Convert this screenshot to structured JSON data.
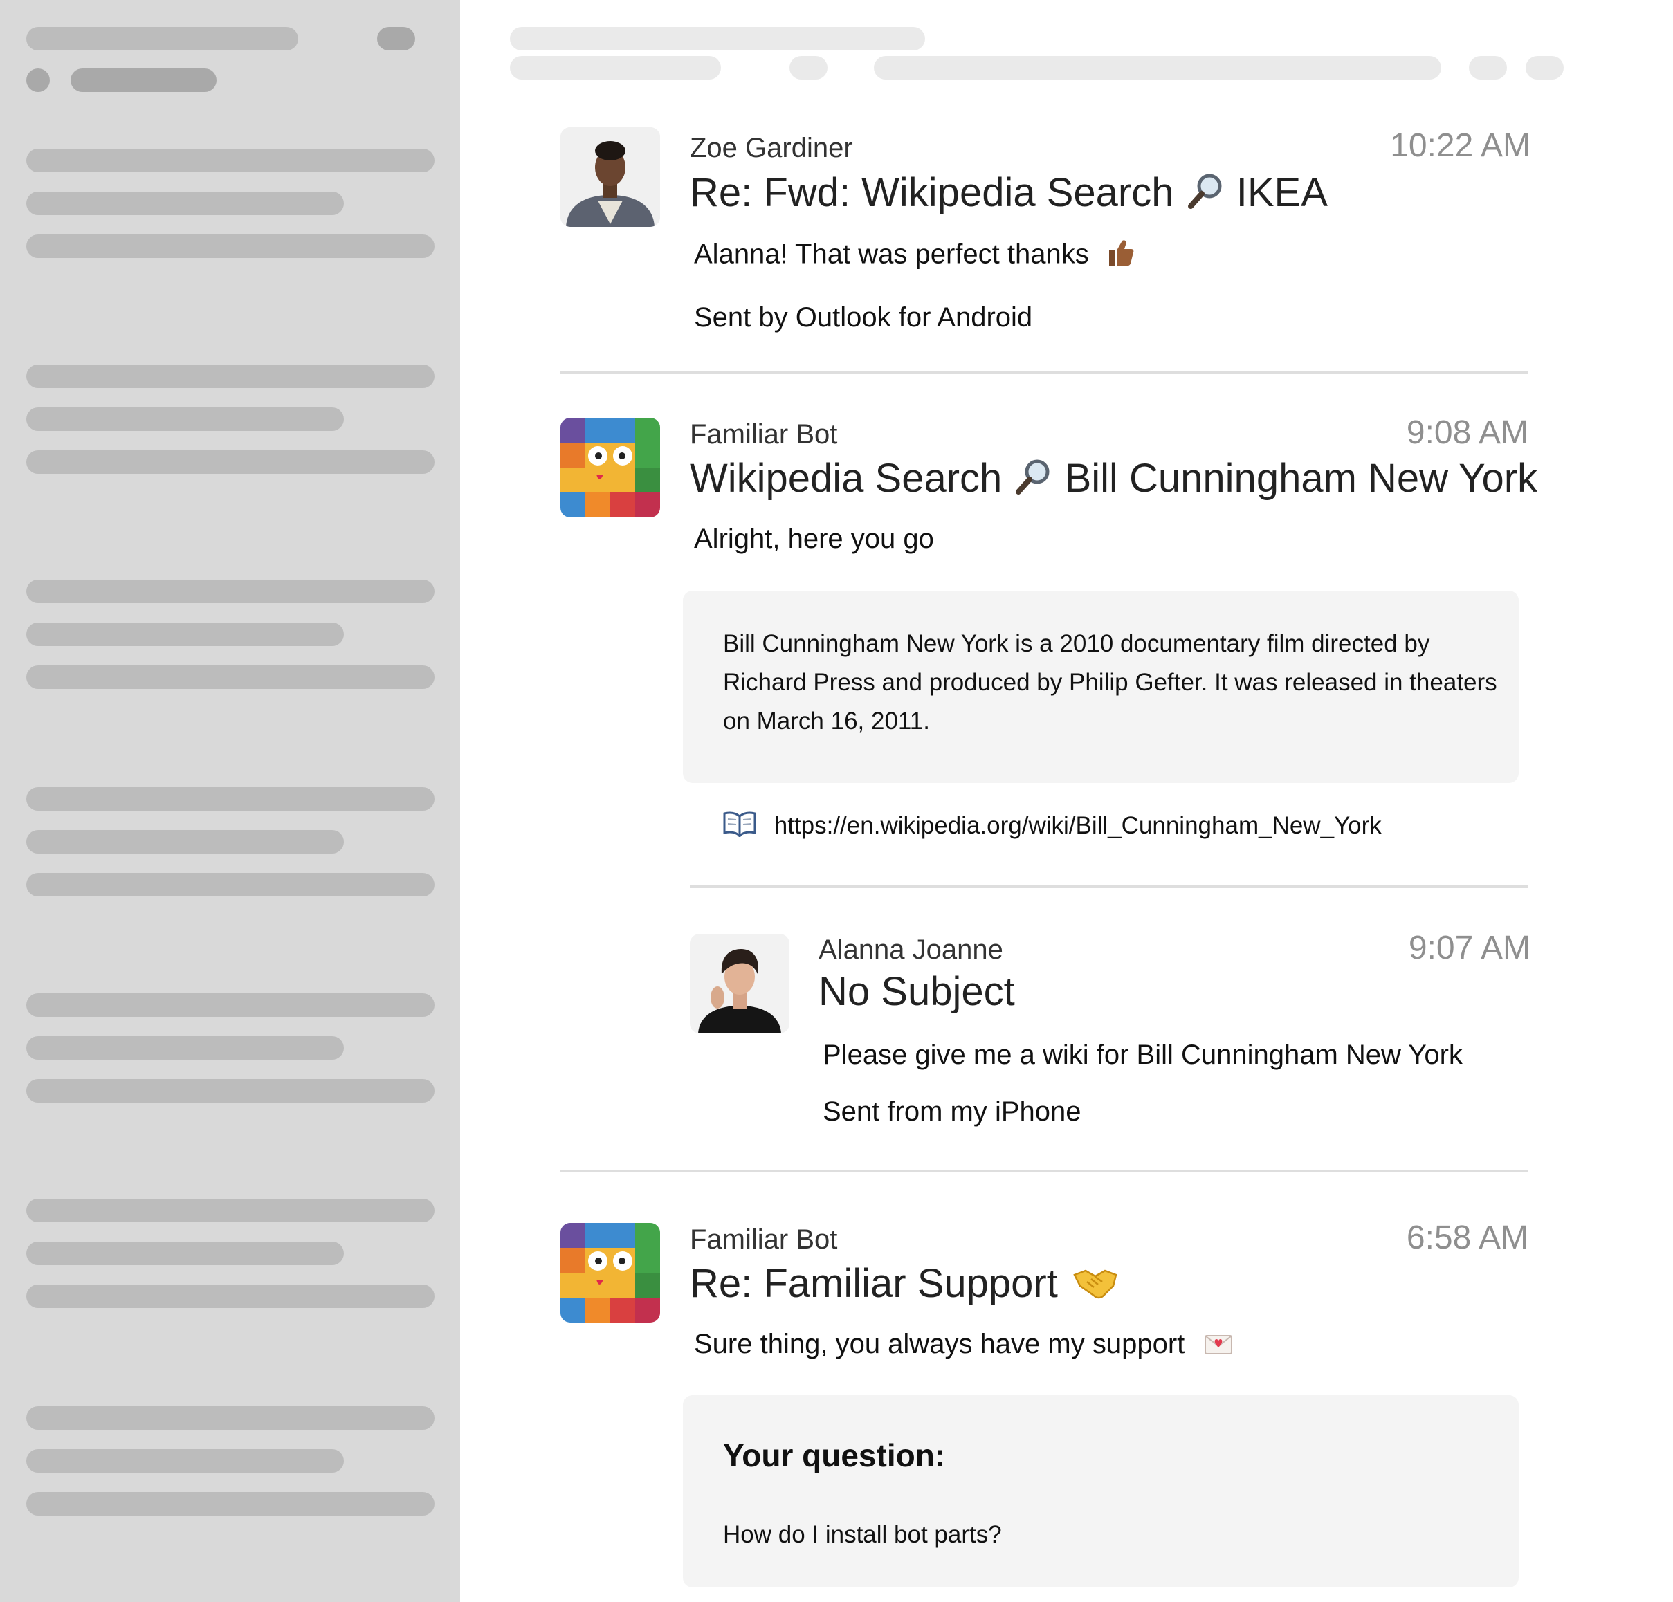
{
  "messages": [
    {
      "sender": "Zoe Gardiner",
      "time": "10:22 AM",
      "subject_pre": "Re: Fwd: Wikipedia Search",
      "subject_post": "IKEA",
      "body_lines": [
        "Alanna! That was perfect thanks",
        "Sent by Outlook for Android"
      ]
    },
    {
      "sender": "Familiar Bot",
      "time": "9:08 AM",
      "subject_pre": "Wikipedia Search",
      "subject_post": "Bill Cunningham New York",
      "body_lines": [
        "Alright, here you go"
      ],
      "card_text": "Bill Cunningham New York is a 2010 documentary film directed by Richard Press and produced by Philip Gefter. It was released in theaters on March 16, 2011.",
      "link": "https://en.wikipedia.org/wiki/Bill_Cunningham_New_York"
    },
    {
      "sender": "Alanna Joanne",
      "time": "9:07 AM",
      "subject": "No Subject",
      "body_lines": [
        "Please give me a wiki for Bill Cunningham New York",
        "Sent from my iPhone"
      ]
    },
    {
      "sender": "Familiar Bot",
      "time": "6:58 AM",
      "subject": "Re: Familiar Support",
      "body_lines": [
        "Sure thing, you always have my support"
      ],
      "card_heading": "Your question:",
      "card_text": "How do I install bot parts?"
    }
  ],
  "icons": {
    "search": "magnifier-icon",
    "thumbs_up": "thumbs-up-icon",
    "book": "open-book-icon",
    "handshake": "handshake-icon",
    "love_letter": "love-letter-icon"
  },
  "colors": {
    "sidebar_bg": "#d9d9d9",
    "skeleton": "#bcbcbc",
    "time_text": "#8f8f8f",
    "card_bg": "#f4f4f4",
    "divider": "#dedede"
  }
}
